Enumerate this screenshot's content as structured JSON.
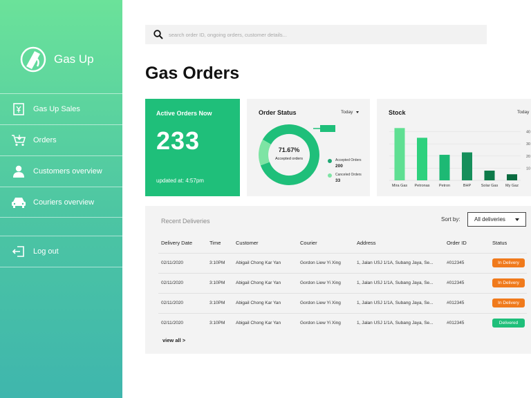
{
  "brand": {
    "name": "Gas Up"
  },
  "sidebar": {
    "items": [
      {
        "label": "Gas Up Sales"
      },
      {
        "label": "Orders"
      },
      {
        "label": "Customers overview"
      },
      {
        "label": "Couriers overview"
      }
    ],
    "logout": "Log out"
  },
  "search": {
    "placeholder": "search order ID, ongoing orders, customer details..."
  },
  "page": {
    "title": "Gas Orders"
  },
  "active_orders": {
    "title": "Active Orders Now",
    "count": "233",
    "updated": "updated at: 4:57pm"
  },
  "order_status": {
    "title": "Order Status",
    "period": "Today",
    "percent": "71.67%",
    "center_label": "Accepted orders",
    "legend": [
      {
        "label": "Accepted Orders",
        "value": "200",
        "color": "#1fa873"
      },
      {
        "label": "Canceled Orders",
        "value": "33",
        "color": "#7ee4a4"
      }
    ]
  },
  "stock": {
    "title": "Stock",
    "period": "Today",
    "y_ticks": [
      "40",
      "30",
      "20",
      "10"
    ]
  },
  "chart_data": [
    {
      "type": "pie",
      "title": "Order Status",
      "categories": [
        "Accepted Orders",
        "Canceled Orders"
      ],
      "values": [
        200,
        33
      ],
      "colors": [
        "#1fbf7a",
        "#7ee4a4"
      ]
    },
    {
      "type": "bar",
      "title": "Stock",
      "categories": [
        "Mira Gas",
        "Petronas",
        "Petron",
        "BHP",
        "Solar Gas",
        "My Gaz"
      ],
      "values": [
        43,
        35,
        21,
        23,
        8,
        5
      ],
      "colors": [
        "#5fdf92",
        "#2ed17e",
        "#1db974",
        "#168f5b",
        "#0d7a49",
        "#0a6a3f"
      ],
      "ylim": [
        0,
        50
      ]
    }
  ],
  "deliveries": {
    "title": "Recent Deliveries",
    "sort_label": "Sort by:",
    "sort_value": "All deliveries",
    "columns": [
      "Delivery Date",
      "Time",
      "Customer",
      "Courier",
      "Address",
      "Order ID",
      "Status"
    ],
    "rows": [
      {
        "date": "02/11/2020",
        "time": "3:10PM",
        "customer": "Abigail Chong Kar Yan",
        "courier": "Gordon Liew Yi Xing",
        "address": "1, Jalan USJ 1/1A, Subang Jaya, Se...",
        "order_id": "#012345",
        "status": "In Delivery",
        "status_color": "#f07a1c"
      },
      {
        "date": "02/11/2020",
        "time": "3:10PM",
        "customer": "Abigail Chong Kar Yan",
        "courier": "Gordon Liew Yi Xing",
        "address": "1, Jalan USJ 1/1A, Subang Jaya, Se...",
        "order_id": "#012345",
        "status": "In Delivery",
        "status_color": "#f07a1c"
      },
      {
        "date": "02/11/2020",
        "time": "3:10PM",
        "customer": "Abigail Chong Kar Yan",
        "courier": "Gordon Liew Yi Xing",
        "address": "1, Jalan USJ 1/1A, Subang Jaya, Se...",
        "order_id": "#012345",
        "status": "In Delivery",
        "status_color": "#f07a1c"
      },
      {
        "date": "02/11/2020",
        "time": "3:10PM",
        "customer": "Abigail Chong Kar Yan",
        "courier": "Gordon Liew Yi Xing",
        "address": "1, Jalan USJ 1/1A, Subang Jaya, Se...",
        "order_id": "#012345",
        "status": "Delivered",
        "status_color": "#1fbf7a"
      }
    ],
    "view_all": "view all >"
  }
}
